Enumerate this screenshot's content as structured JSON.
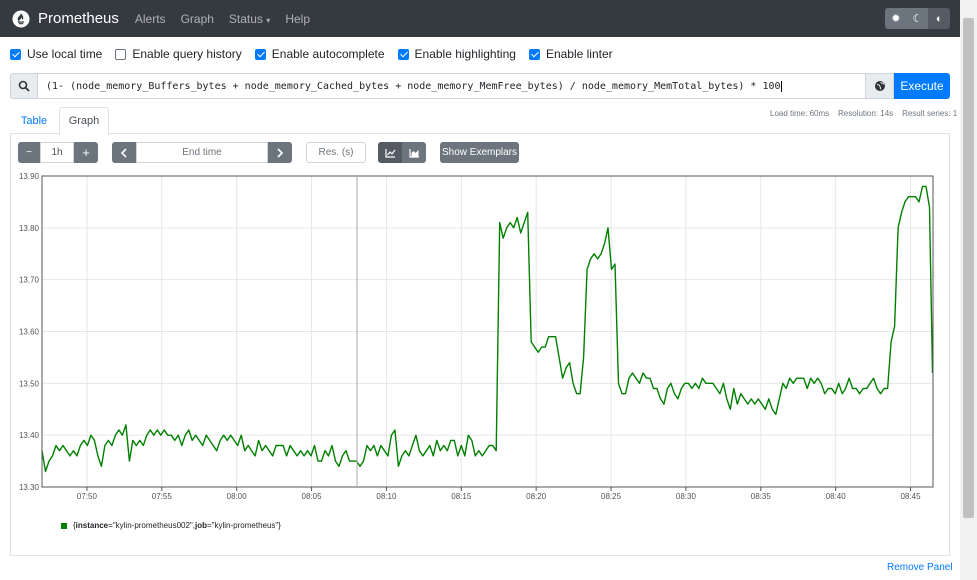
{
  "navbar": {
    "brand": "Prometheus",
    "links": [
      "Alerts",
      "Graph",
      "Status",
      "Help"
    ],
    "theme_icons": [
      "sun-icon",
      "moon-icon",
      "contrast-icon"
    ]
  },
  "options": [
    {
      "label": "Use local time",
      "checked": true
    },
    {
      "label": "Enable query history",
      "checked": false
    },
    {
      "label": "Enable autocomplete",
      "checked": true
    },
    {
      "label": "Enable highlighting",
      "checked": true
    },
    {
      "label": "Enable linter",
      "checked": true
    }
  ],
  "query": {
    "expression": "(1- (node_memory_Buffers_bytes + node_memory_Cached_bytes + node_memory_MemFree_bytes) / node_memory_MemTotal_bytes) * 100",
    "execute_label": "Execute"
  },
  "stats": {
    "load_time": "Load time: 60ms",
    "resolution": "Resolution: 14s",
    "result_series": "Result series: 1"
  },
  "tabs": [
    "Table",
    "Graph"
  ],
  "controls": {
    "minus": "−",
    "range": "1h",
    "plus": "+",
    "end_time_placeholder": "End time",
    "res_placeholder": "Res. (s)",
    "show_exemplars": "Show Exemplars"
  },
  "legend": {
    "open_brace": "{",
    "instance_key": "instance",
    "instance_value": "=\"kylin-prometheus002\", ",
    "job_key": "job",
    "job_value": "=\"kylin-prometheus\"}"
  },
  "remove_panel": "Remove Panel",
  "colors": {
    "series": "#008000",
    "accent": "#007bff",
    "navbar": "#343a40"
  },
  "chart_data": {
    "type": "line",
    "ylim": [
      13.3,
      13.9
    ],
    "yticks": [
      "13.30",
      "13.40",
      "13.50",
      "13.60",
      "13.70",
      "13.80",
      "13.90"
    ],
    "xticks": [
      "07:50",
      "07:55",
      "08:00",
      "08:05",
      "08:10",
      "08:15",
      "08:20",
      "08:25",
      "08:30",
      "08:35",
      "08:40",
      "08:45"
    ],
    "x_start": "07:47:00",
    "grid": true,
    "series": [
      {
        "values": [
          [
            "07:47:00",
            13.37
          ],
          [
            "07:47:14",
            13.33
          ],
          [
            "07:47:28",
            13.35
          ],
          [
            "07:47:42",
            13.36
          ],
          [
            "07:47:56",
            13.38
          ],
          [
            "07:48:10",
            13.37
          ],
          [
            "07:48:24",
            13.38
          ],
          [
            "07:48:38",
            13.37
          ],
          [
            "07:48:52",
            13.36
          ],
          [
            "07:49:06",
            13.37
          ],
          [
            "07:49:20",
            13.36
          ],
          [
            "07:49:34",
            13.38
          ],
          [
            "07:49:48",
            13.39
          ],
          [
            "07:50:02",
            13.38
          ],
          [
            "07:50:16",
            13.4
          ],
          [
            "07:50:30",
            13.39
          ],
          [
            "07:50:44",
            13.36
          ],
          [
            "07:50:58",
            13.34
          ],
          [
            "07:51:12",
            13.38
          ],
          [
            "07:51:26",
            13.39
          ],
          [
            "07:51:40",
            13.38
          ],
          [
            "07:51:54",
            13.4
          ],
          [
            "07:52:08",
            13.41
          ],
          [
            "07:52:22",
            13.4
          ],
          [
            "07:52:36",
            13.42
          ],
          [
            "07:52:50",
            13.35
          ],
          [
            "07:53:04",
            13.39
          ],
          [
            "07:53:18",
            13.38
          ],
          [
            "07:53:32",
            13.39
          ],
          [
            "07:53:46",
            13.38
          ],
          [
            "07:54:00",
            13.4
          ],
          [
            "07:54:14",
            13.41
          ],
          [
            "07:54:28",
            13.4
          ],
          [
            "07:54:42",
            13.41
          ],
          [
            "07:54:56",
            13.4
          ],
          [
            "07:55:10",
            13.41
          ],
          [
            "07:55:24",
            13.4
          ],
          [
            "07:55:38",
            13.4
          ],
          [
            "07:55:52",
            13.39
          ],
          [
            "07:56:06",
            13.4
          ],
          [
            "07:56:20",
            13.38
          ],
          [
            "07:56:34",
            13.4
          ],
          [
            "07:56:48",
            13.41
          ],
          [
            "07:57:02",
            13.39
          ],
          [
            "07:57:16",
            13.4
          ],
          [
            "07:57:30",
            13.39
          ],
          [
            "07:57:44",
            13.38
          ],
          [
            "07:57:58",
            13.4
          ],
          [
            "07:58:12",
            13.39
          ],
          [
            "07:58:26",
            13.38
          ],
          [
            "07:58:40",
            13.37
          ],
          [
            "07:58:54",
            13.39
          ],
          [
            "07:59:08",
            13.4
          ],
          [
            "07:59:22",
            13.39
          ],
          [
            "07:59:36",
            13.4
          ],
          [
            "07:59:50",
            13.39
          ],
          [
            "08:00:04",
            13.38
          ],
          [
            "08:00:18",
            13.4
          ],
          [
            "08:00:32",
            13.37
          ],
          [
            "08:00:46",
            13.38
          ],
          [
            "08:01:00",
            13.37
          ],
          [
            "08:01:14",
            13.36
          ],
          [
            "08:01:28",
            13.39
          ],
          [
            "08:01:42",
            13.37
          ],
          [
            "08:01:56",
            13.38
          ],
          [
            "08:02:10",
            13.37
          ],
          [
            "08:02:24",
            13.36
          ],
          [
            "08:02:38",
            13.38
          ],
          [
            "08:02:52",
            13.38
          ],
          [
            "08:03:06",
            13.38
          ],
          [
            "08:03:20",
            13.36
          ],
          [
            "08:03:34",
            13.38
          ],
          [
            "08:03:48",
            13.37
          ],
          [
            "08:04:02",
            13.36
          ],
          [
            "08:04:16",
            13.37
          ],
          [
            "08:04:30",
            13.36
          ],
          [
            "08:04:44",
            13.37
          ],
          [
            "08:04:58",
            13.36
          ],
          [
            "08:05:12",
            13.38
          ],
          [
            "08:05:26",
            13.35
          ],
          [
            "08:05:40",
            13.35
          ],
          [
            "08:05:54",
            13.37
          ],
          [
            "08:06:08",
            13.36
          ],
          [
            "08:06:22",
            13.38
          ],
          [
            "08:06:36",
            13.35
          ],
          [
            "08:06:50",
            13.34
          ],
          [
            "08:07:04",
            13.36
          ],
          [
            "08:07:18",
            13.37
          ],
          [
            "08:07:32",
            13.35
          ],
          [
            "08:07:46",
            13.35
          ],
          [
            "08:08:00",
            13.35
          ],
          [
            "08:08:14",
            13.34
          ],
          [
            "08:08:28",
            13.35
          ],
          [
            "08:08:42",
            13.38
          ],
          [
            "08:08:56",
            13.37
          ],
          [
            "08:09:10",
            13.38
          ],
          [
            "08:09:24",
            13.36
          ],
          [
            "08:09:38",
            13.38
          ],
          [
            "08:09:52",
            13.37
          ],
          [
            "08:10:06",
            13.36
          ],
          [
            "08:10:20",
            13.4
          ],
          [
            "08:10:34",
            13.41
          ],
          [
            "08:10:48",
            13.34
          ],
          [
            "08:11:02",
            13.36
          ],
          [
            "08:11:16",
            13.37
          ],
          [
            "08:11:30",
            13.36
          ],
          [
            "08:11:44",
            13.38
          ],
          [
            "08:11:58",
            13.4
          ],
          [
            "08:12:12",
            13.37
          ],
          [
            "08:12:26",
            13.36
          ],
          [
            "08:12:40",
            13.37
          ],
          [
            "08:12:54",
            13.38
          ],
          [
            "08:13:08",
            13.36
          ],
          [
            "08:13:22",
            13.39
          ],
          [
            "08:13:36",
            13.37
          ],
          [
            "08:13:50",
            13.38
          ],
          [
            "08:14:04",
            13.37
          ],
          [
            "08:14:18",
            13.39
          ],
          [
            "08:14:32",
            13.39
          ],
          [
            "08:14:46",
            13.36
          ],
          [
            "08:15:00",
            13.38
          ],
          [
            "08:15:14",
            13.36
          ],
          [
            "08:15:28",
            13.4
          ],
          [
            "08:15:42",
            13.39
          ],
          [
            "08:15:56",
            13.36
          ],
          [
            "08:16:10",
            13.37
          ],
          [
            "08:16:24",
            13.36
          ],
          [
            "08:16:38",
            13.37
          ],
          [
            "08:16:52",
            13.38
          ],
          [
            "08:17:06",
            13.38
          ],
          [
            "08:17:20",
            13.37
          ],
          [
            "08:17:34",
            13.81
          ],
          [
            "08:17:48",
            13.78
          ],
          [
            "08:18:02",
            13.8
          ],
          [
            "08:18:16",
            13.81
          ],
          [
            "08:18:30",
            13.8
          ],
          [
            "08:18:44",
            13.82
          ],
          [
            "08:18:58",
            13.79
          ],
          [
            "08:19:12",
            13.81
          ],
          [
            "08:19:26",
            13.83
          ],
          [
            "08:19:40",
            13.58
          ],
          [
            "08:19:54",
            13.57
          ],
          [
            "08:20:08",
            13.56
          ],
          [
            "08:20:22",
            13.57
          ],
          [
            "08:20:36",
            13.57
          ],
          [
            "08:20:50",
            13.59
          ],
          [
            "08:21:04",
            13.59
          ],
          [
            "08:21:18",
            13.59
          ],
          [
            "08:21:32",
            13.55
          ],
          [
            "08:21:46",
            13.51
          ],
          [
            "08:22:00",
            13.53
          ],
          [
            "08:22:14",
            13.54
          ],
          [
            "08:22:28",
            13.5
          ],
          [
            "08:22:42",
            13.48
          ],
          [
            "08:22:56",
            13.48
          ],
          [
            "08:23:10",
            13.55
          ],
          [
            "08:23:24",
            13.72
          ],
          [
            "08:23:38",
            13.74
          ],
          [
            "08:23:52",
            13.75
          ],
          [
            "08:24:06",
            13.74
          ],
          [
            "08:24:20",
            13.75
          ],
          [
            "08:24:34",
            13.77
          ],
          [
            "08:24:48",
            13.8
          ],
          [
            "08:25:02",
            13.72
          ],
          [
            "08:25:16",
            13.73
          ],
          [
            "08:25:30",
            13.5
          ],
          [
            "08:25:44",
            13.48
          ],
          [
            "08:25:58",
            13.48
          ],
          [
            "08:26:12",
            13.51
          ],
          [
            "08:26:26",
            13.52
          ],
          [
            "08:26:40",
            13.51
          ],
          [
            "08:26:54",
            13.5
          ],
          [
            "08:27:08",
            13.52
          ],
          [
            "08:27:22",
            13.51
          ],
          [
            "08:27:36",
            13.51
          ],
          [
            "08:27:50",
            13.49
          ],
          [
            "08:28:04",
            13.49
          ],
          [
            "08:28:18",
            13.47
          ],
          [
            "08:28:32",
            13.46
          ],
          [
            "08:28:46",
            13.49
          ],
          [
            "08:29:00",
            13.5
          ],
          [
            "08:29:14",
            13.48
          ],
          [
            "08:29:28",
            13.47
          ],
          [
            "08:29:42",
            13.49
          ],
          [
            "08:29:56",
            13.5
          ],
          [
            "08:30:10",
            13.5
          ],
          [
            "08:30:24",
            13.49
          ],
          [
            "08:30:38",
            13.5
          ],
          [
            "08:30:52",
            13.49
          ],
          [
            "08:31:06",
            13.51
          ],
          [
            "08:31:20",
            13.5
          ],
          [
            "08:31:34",
            13.5
          ],
          [
            "08:31:48",
            13.5
          ],
          [
            "08:32:02",
            13.49
          ],
          [
            "08:32:16",
            13.48
          ],
          [
            "08:32:30",
            13.5
          ],
          [
            "08:32:44",
            13.47
          ],
          [
            "08:32:58",
            13.45
          ],
          [
            "08:33:12",
            13.49
          ],
          [
            "08:33:26",
            13.46
          ],
          [
            "08:33:40",
            13.48
          ],
          [
            "08:33:54",
            13.47
          ],
          [
            "08:34:08",
            13.46
          ],
          [
            "08:34:22",
            13.47
          ],
          [
            "08:34:36",
            13.46
          ],
          [
            "08:34:50",
            13.47
          ],
          [
            "08:35:04",
            13.46
          ],
          [
            "08:35:18",
            13.45
          ],
          [
            "08:35:32",
            13.47
          ],
          [
            "08:35:46",
            13.45
          ],
          [
            "08:36:00",
            13.44
          ],
          [
            "08:36:14",
            13.47
          ],
          [
            "08:36:28",
            13.5
          ],
          [
            "08:36:42",
            13.49
          ],
          [
            "08:36:56",
            13.51
          ],
          [
            "08:37:10",
            13.5
          ],
          [
            "08:37:24",
            13.51
          ],
          [
            "08:37:38",
            13.51
          ],
          [
            "08:37:52",
            13.51
          ],
          [
            "08:38:06",
            13.49
          ],
          [
            "08:38:20",
            13.51
          ],
          [
            "08:38:34",
            13.5
          ],
          [
            "08:38:48",
            13.51
          ],
          [
            "08:39:02",
            13.5
          ],
          [
            "08:39:16",
            13.48
          ],
          [
            "08:39:30",
            13.49
          ],
          [
            "08:39:44",
            13.49
          ],
          [
            "08:39:58",
            13.48
          ],
          [
            "08:40:12",
            13.5
          ],
          [
            "08:40:26",
            13.48
          ],
          [
            "08:40:40",
            13.49
          ],
          [
            "08:40:54",
            13.51
          ],
          [
            "08:41:08",
            13.49
          ],
          [
            "08:41:22",
            13.49
          ],
          [
            "08:41:36",
            13.48
          ],
          [
            "08:41:50",
            13.49
          ],
          [
            "08:42:04",
            13.49
          ],
          [
            "08:42:18",
            13.5
          ],
          [
            "08:42:32",
            13.51
          ],
          [
            "08:42:46",
            13.49
          ],
          [
            "08:43:00",
            13.48
          ],
          [
            "08:43:14",
            13.49
          ],
          [
            "08:43:28",
            13.49
          ],
          [
            "08:43:42",
            13.58
          ],
          [
            "08:43:56",
            13.61
          ],
          [
            "08:44:10",
            13.8
          ],
          [
            "08:44:24",
            13.83
          ],
          [
            "08:44:38",
            13.85
          ],
          [
            "08:44:52",
            13.86
          ],
          [
            "08:45:06",
            13.86
          ],
          [
            "08:45:20",
            13.86
          ],
          [
            "08:45:34",
            13.85
          ],
          [
            "08:45:48",
            13.88
          ],
          [
            "08:46:02",
            13.88
          ],
          [
            "08:46:16",
            13.84
          ],
          [
            "08:46:30",
            13.52
          ]
        ]
      }
    ]
  }
}
